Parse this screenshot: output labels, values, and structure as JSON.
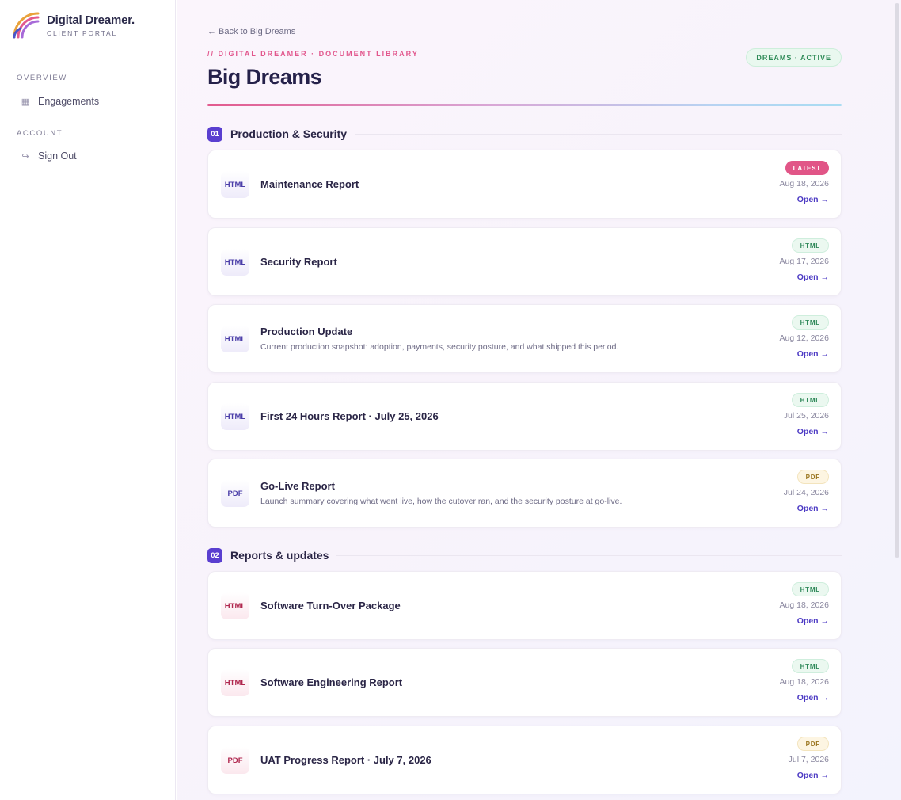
{
  "brand": {
    "name": "Digital Dreamer.",
    "subtitle": "CLIENT PORTAL"
  },
  "sidebar": {
    "overview_label": "OVERVIEW",
    "engagements_label": "Engagements",
    "account_label": "ACCOUNT",
    "signout_label": "Sign Out"
  },
  "header": {
    "back_link": "← Back to Big Dreams",
    "eyebrow": "// DIGITAL DREAMER · DOCUMENT LIBRARY",
    "title": "Big Dreams",
    "status": "DREAMS · ACTIVE"
  },
  "sections": [
    {
      "number": "01",
      "title": "Production & Security",
      "items": [
        {
          "icon": "HTML",
          "title": "Maintenance Report",
          "description": "",
          "badge": "LATEST",
          "date": "Aug 18, 2026",
          "open": "Open →"
        },
        {
          "icon": "HTML",
          "title": "Security Report",
          "description": "",
          "badge": "HTML",
          "date": "Aug 17, 2026",
          "open": "Open →"
        },
        {
          "icon": "HTML",
          "title": "Production Update",
          "description": "Current production snapshot: adoption, payments, security posture, and what shipped this period.",
          "badge": "HTML",
          "date": "Aug 12, 2026",
          "open": "Open →"
        },
        {
          "icon": "HTML",
          "title": "First 24 Hours Report · July 25, 2026",
          "description": "",
          "badge": "HTML",
          "date": "Jul 25, 2026",
          "open": "Open →"
        },
        {
          "icon": "PDF",
          "title": "Go-Live Report",
          "description": "Launch summary covering what went live, how the cutover ran, and the security posture at go-live.",
          "badge": "PDF",
          "date": "Jul 24, 2026",
          "open": "Open →"
        }
      ]
    },
    {
      "number": "02",
      "title": "Reports & updates",
      "items": [
        {
          "icon": "HTML",
          "title": "Software Turn-Over Package",
          "description": "",
          "badge": "HTML",
          "date": "Aug 18, 2026",
          "open": "Open →"
        },
        {
          "icon": "HTML",
          "title": "Software Engineering Report",
          "description": "",
          "badge": "HTML",
          "date": "Aug 18, 2026",
          "open": "Open →"
        },
        {
          "icon": "PDF",
          "title": "UAT Progress Report · July 7, 2026",
          "description": "",
          "badge": "PDF",
          "date": "Jul 7, 2026",
          "open": "Open →"
        }
      ]
    }
  ],
  "colors": {
    "accent": "#5a3fd0",
    "latest": "#e15587",
    "html_badge": "#318a5b",
    "pdf_badge": "#9b7620"
  }
}
